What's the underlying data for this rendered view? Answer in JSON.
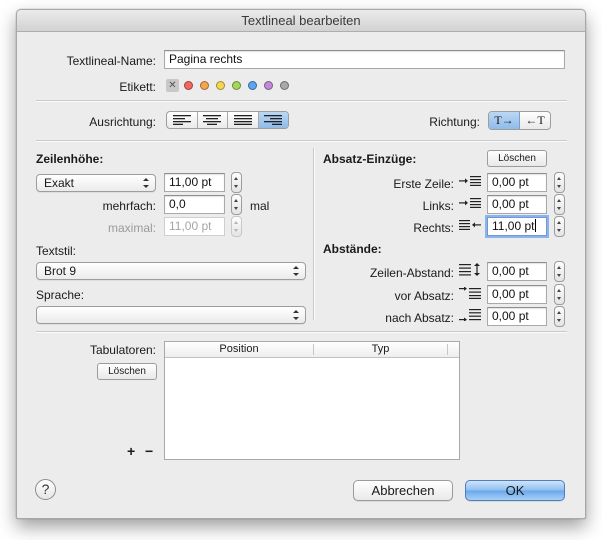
{
  "window": {
    "title": "Textlineal bearbeiten"
  },
  "name": {
    "label": "Textlineal-Name:",
    "value": "Pagina rechts"
  },
  "label_row": {
    "label": "Etikett:",
    "none_glyph": "✕",
    "colors": [
      "#f0675f",
      "#f6a54d",
      "#f2d750",
      "#a5d65b",
      "#5ea4f0",
      "#c08ad8",
      "#a9a9a9"
    ]
  },
  "alignment": {
    "label": "Ausrichtung:",
    "options": [
      "align-left-icon",
      "align-center-icon",
      "align-justify-icon",
      "align-right-icon"
    ],
    "selected_index": 3
  },
  "direction": {
    "label": "Richtung:",
    "ltr": "T→",
    "rtl": "←T",
    "selected": "ltr"
  },
  "line_height": {
    "heading": "Zeilenhöhe:",
    "mode": "Exakt",
    "value": "11,00 pt",
    "multiple_label": "mehrfach:",
    "multiple_value": "0,0",
    "multiple_unit": "mal",
    "max_label": "maximal:",
    "max_value": "11,00 pt"
  },
  "text_style": {
    "label": "Textstil:",
    "value": "Brot 9"
  },
  "language": {
    "label": "Sprache:",
    "value": ""
  },
  "indents": {
    "heading": "Absatz-Einzüge:",
    "clear_label": "Löschen",
    "first_line_label": "Erste Zeile:",
    "first_line_value": "0,00 pt",
    "left_label": "Links:",
    "left_value": "0,00 pt",
    "right_label": "Rechts:",
    "right_value": "11,00 pt"
  },
  "spacing": {
    "heading": "Abstände:",
    "line_label": "Zeilen-Abstand:",
    "line_value": "0,00 pt",
    "before_label": "vor Absatz:",
    "before_value": "0,00 pt",
    "after_label": "nach Absatz:",
    "after_value": "0,00 pt"
  },
  "tabs": {
    "label": "Tabulatoren:",
    "clear_label": "Löschen",
    "columns": [
      "Position",
      "Typ"
    ],
    "rows": [],
    "add_glyph": "+",
    "remove_glyph": "−"
  },
  "footer": {
    "help_glyph": "?",
    "cancel_label": "Abbrechen",
    "ok_label": "OK"
  }
}
